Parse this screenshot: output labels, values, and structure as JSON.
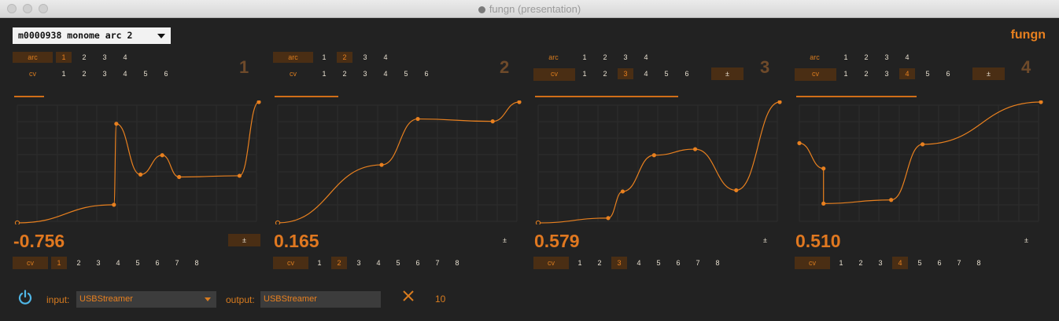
{
  "window": {
    "title": "fungn (presentation)"
  },
  "device": {
    "selected": "m0000938 monome arc 2"
  },
  "brand": "fungn",
  "row_labels": {
    "arc": "arc",
    "cv": "cv"
  },
  "arc_options": [
    "1",
    "2",
    "3",
    "4"
  ],
  "cv_options_top": [
    "1",
    "2",
    "3",
    "4",
    "5",
    "6"
  ],
  "cv_options_bottom": [
    "1",
    "2",
    "3",
    "4",
    "5",
    "6",
    "7",
    "8"
  ],
  "pm_symbol": "±",
  "panels": [
    {
      "channel": "1",
      "value": "-0.756",
      "arc_selected": "1",
      "cv_selected": "1",
      "top_cv_selected": null,
      "cv_top_boxed": false,
      "pm_top": false,
      "pm_bottom_boxed": true,
      "bar_fraction": 0.12,
      "curve": [
        [
          0,
          0.0
        ],
        [
          0.4,
          0.15
        ],
        [
          0.41,
          0.82
        ],
        [
          0.51,
          0.4
        ],
        [
          0.6,
          0.56
        ],
        [
          0.67,
          0.38
        ],
        [
          0.92,
          0.39
        ],
        [
          1.0,
          1.0
        ]
      ]
    },
    {
      "channel": "2",
      "value": "0.165",
      "arc_selected": "2",
      "cv_selected": "2",
      "top_cv_selected": null,
      "cv_top_boxed": false,
      "pm_top": false,
      "pm_bottom_boxed": false,
      "bar_fraction": 0.26,
      "curve": [
        [
          0,
          0.0
        ],
        [
          0.43,
          0.48
        ],
        [
          0.58,
          0.86
        ],
        [
          0.89,
          0.84
        ],
        [
          1.0,
          1.0
        ]
      ]
    },
    {
      "channel": "3",
      "value": "0.579",
      "arc_selected": null,
      "cv_selected": "3",
      "top_cv_selected": "3",
      "cv_top_boxed": true,
      "pm_top": true,
      "pm_bottom_boxed": false,
      "bar_fraction": 0.58,
      "curve": [
        [
          0,
          0.0
        ],
        [
          0.29,
          0.04
        ],
        [
          0.35,
          0.26
        ],
        [
          0.48,
          0.56
        ],
        [
          0.65,
          0.61
        ],
        [
          0.82,
          0.27
        ],
        [
          1.0,
          1.0
        ]
      ]
    },
    {
      "channel": "4",
      "value": "0.510",
      "arc_selected": null,
      "cv_selected": "4",
      "top_cv_selected": "4",
      "cv_top_boxed": true,
      "pm_top": true,
      "pm_bottom_boxed": false,
      "bar_fraction": 0.49,
      "curve": [
        [
          0,
          0.66
        ],
        [
          0.1,
          0.45
        ],
        [
          0.1,
          0.16
        ],
        [
          0.38,
          0.19
        ],
        [
          0.51,
          0.65
        ],
        [
          1.0,
          1.0
        ]
      ]
    }
  ],
  "bottom": {
    "input_label": "input:",
    "input_value": "USBStreamer",
    "output_label": "output:",
    "output_value": "USBStreamer",
    "count": "10"
  },
  "colors": {
    "accent": "#e8801f",
    "selected_bg": "#4a2e14",
    "background": "#222222",
    "grid": "#2d2d2d"
  }
}
